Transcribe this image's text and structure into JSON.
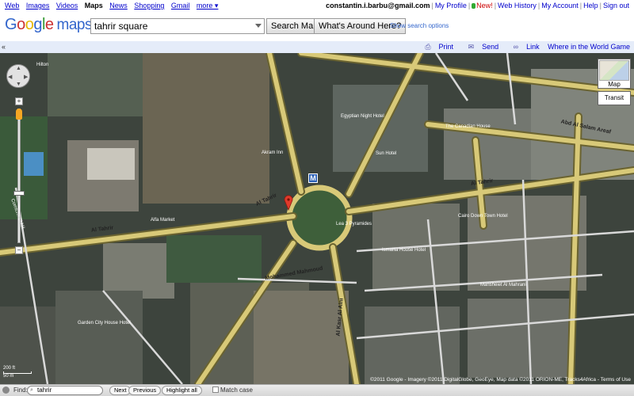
{
  "gbar": {
    "left_links": [
      "Web",
      "Images",
      "Videos",
      "Maps",
      "News",
      "Shopping",
      "Gmail",
      "more ▾"
    ],
    "active": "Maps",
    "email": "constantin.i.barbu@gmail.com",
    "my_profile": "My Profile",
    "new_label": "New!",
    "web_history": "Web History",
    "my_account": "My Account",
    "help": "Help",
    "sign_out": "Sign out"
  },
  "header": {
    "logo_maps": "maps",
    "search_value": "tahrir square",
    "search_button": "Search Maps",
    "around_button": "What's Around Here?",
    "show_options": "Show search options"
  },
  "actionbar": {
    "collapse": "«",
    "print": "Print",
    "send": "Send",
    "link": "Link",
    "game": "Where in the World Game"
  },
  "map": {
    "maptype_label": "Map",
    "transit_label": "Transit",
    "metro_label": "M",
    "scale_top": "200 ft",
    "scale_bottom": "50 m",
    "copyright": "©2011 Google - Imagery ©2011 DigitalGlobe, GeoEye, Map data ©2011 ORION-ME, Tracks4Africa - Terms of Use",
    "labels": {
      "al_tahrir_left": "Al Tahrir",
      "al_tahrir_center": "Al Tahrir",
      "al_tahrir_right": "Al Tahrir",
      "abd_al_salam": "Abd Al Salam Areaf",
      "kasr_al_aini": "Al Kasr Al Aini",
      "mohammed_mahmoud": "Mohammed Mahmoud",
      "mansheiet": "Mansheiet Al Mahrani",
      "akram": "Akram Inn",
      "egyptian_night": "Egyptian Night Hotel",
      "sun_hotel": "Sun Hotel",
      "canadian_house": "The Canadian House",
      "cairo_down_town": "Cairo Down Town Hotel",
      "ismailia": "Ismailia House Hotel",
      "garden_city": "Garden City House Hotel",
      "alfa_market": "Alfa Market",
      "lea3": "Lea 3 Pyramides",
      "hilton": "Hilton",
      "corniche": "Corniche El Nil"
    }
  },
  "findbar": {
    "find_label": "Find:",
    "find_value": "tahrir",
    "next": "Next",
    "previous": "Previous",
    "highlight": "Highlight all",
    "match_case": "Match case"
  },
  "colors": {
    "road_fill": "#d8c978",
    "road_edge": "#6a6330",
    "actionbar_bg": "#e5ecf9",
    "link": "#0000cc"
  }
}
